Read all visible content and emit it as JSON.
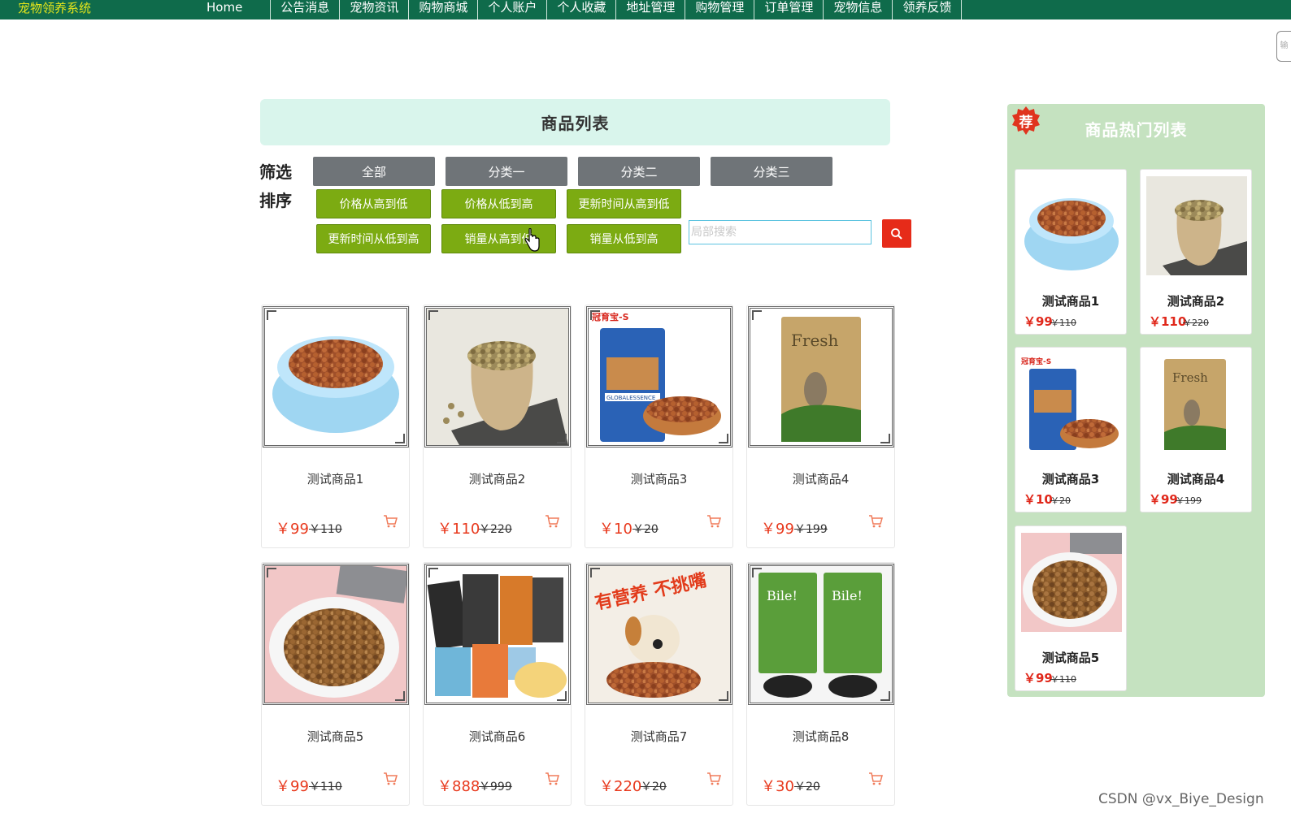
{
  "nav": {
    "brand": "宠物领养系统",
    "items": [
      "Home",
      "公告消息",
      "宠物资讯",
      "购物商城",
      "个人账户",
      "个人收藏",
      "地址管理",
      "购物管理",
      "订单管理",
      "宠物信息",
      "领养反馈"
    ]
  },
  "main": {
    "title": "商品列表",
    "filter_label": "筛选",
    "sort_label": "排序",
    "categories": [
      "全部",
      "分类一",
      "分类二",
      "分类三"
    ],
    "sorts": [
      "价格从高到低",
      "价格从低到高",
      "更新时间从高到低",
      "更新时间从低到高",
      "销量从高到低",
      "销量从低到高"
    ],
    "search_placeholder": "局部搜索"
  },
  "products": [
    {
      "name": "测试商品1",
      "price": "￥99",
      "old_price": "￥110",
      "image": "blue-bowl-kibble"
    },
    {
      "name": "测试商品2",
      "price": "￥110",
      "old_price": "￥220",
      "image": "burlap-sack-kibble"
    },
    {
      "name": "测试商品3",
      "price": "￥10",
      "old_price": "￥20",
      "image": "blue-cat-food-bag"
    },
    {
      "name": "测试商品4",
      "price": "￥99",
      "old_price": "￥199",
      "image": "fresh-kraft-bag"
    },
    {
      "name": "测试商品5",
      "price": "￥99",
      "old_price": "￥110",
      "image": "plate-of-kibble"
    },
    {
      "name": "测试商品6",
      "price": "￥888",
      "old_price": "￥999",
      "image": "dog-treat-packs"
    },
    {
      "name": "测试商品7",
      "price": "￥220",
      "old_price": "￥20",
      "image": "dog-ad-poster"
    },
    {
      "name": "测试商品8",
      "price": "￥30",
      "old_price": "￥20",
      "image": "green-bile-bags"
    }
  ],
  "hot": {
    "badge": "荐",
    "title": "商品热门列表",
    "items": [
      {
        "name": "测试商品1",
        "price": "￥99",
        "old_price": "￥110",
        "image": "blue-bowl-kibble"
      },
      {
        "name": "测试商品2",
        "price": "￥110",
        "old_price": "￥220",
        "image": "burlap-sack-kibble"
      },
      {
        "name": "测试商品3",
        "price": "￥10",
        "old_price": "￥20",
        "image": "blue-cat-food-bag"
      },
      {
        "name": "测试商品4",
        "price": "￥99",
        "old_price": "￥199",
        "image": "fresh-kraft-bag"
      },
      {
        "name": "测试商品5",
        "price": "￥99",
        "old_price": "￥110",
        "image": "plate-of-kibble"
      }
    ]
  },
  "pictures": {
    "bag3_brand": "冠育宝-S",
    "bag3_label": "GLOBALESSENCE",
    "bag4_label": "Fresh",
    "poster7": "有营养 不挑嘴",
    "bag8_label": "Bile!"
  },
  "edge_tab": "输",
  "watermark": "CSDN @vx_Biye_Design",
  "colors": {
    "nav_bg": "#0f6b4b",
    "brand": "#e5e61b",
    "title_bg": "#d9f5ec",
    "category_btn": "#6f7478",
    "sort_btn": "#7cab12",
    "search_btn": "#e62b19",
    "price": "#e8391d",
    "hot_panel": "#c5e2c0"
  }
}
